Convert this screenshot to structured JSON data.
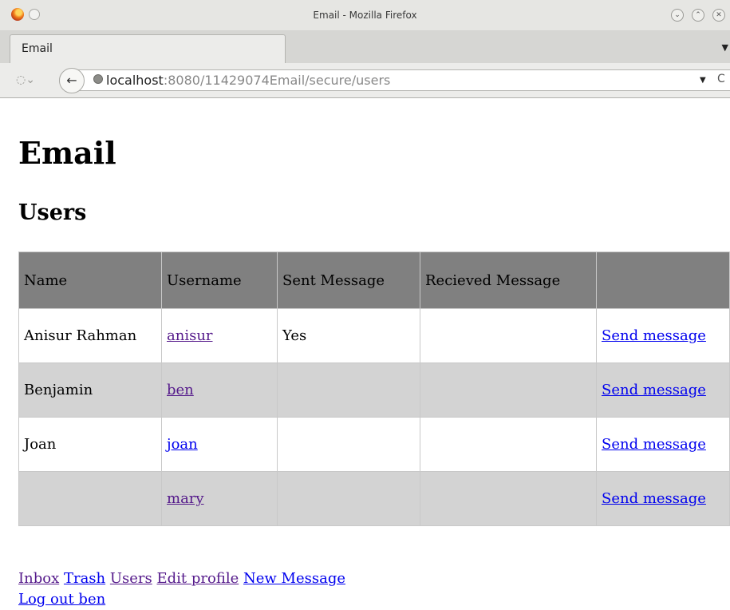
{
  "window": {
    "title": "Email - Mozilla Firefox",
    "minimize_label": "⌄",
    "maximize_label": "⌃",
    "close_label": "✕"
  },
  "tab": {
    "label": "Email",
    "dropdown_glyph": "▼"
  },
  "nav": {
    "url_prefix": "localhost",
    "url_suffix": ":8080/11429074Email/secure/users",
    "back_glyph": "←",
    "dropdown_glyph": "▼",
    "reload_glyph": "C"
  },
  "page": {
    "title": "Email",
    "subtitle": "Users",
    "table": {
      "headers": [
        "Name",
        "Username",
        "Sent Message",
        "Recieved Message",
        ""
      ],
      "rows": [
        {
          "name": "Anisur Rahman",
          "username": "anisur",
          "sent": "Yes",
          "received": "",
          "action": "Send message"
        },
        {
          "name": "Benjamin",
          "username": "ben",
          "sent": "",
          "received": "",
          "action": "Send message"
        },
        {
          "name": "Joan",
          "username": "joan",
          "sent": "",
          "received": "",
          "action": "Send message"
        },
        {
          "name": "",
          "username": "mary",
          "sent": "",
          "received": "",
          "action": "Send message"
        }
      ]
    },
    "footer_links": [
      "Inbox",
      "Trash",
      "Users",
      "Edit profile",
      "New Message",
      "Log out ben"
    ]
  }
}
